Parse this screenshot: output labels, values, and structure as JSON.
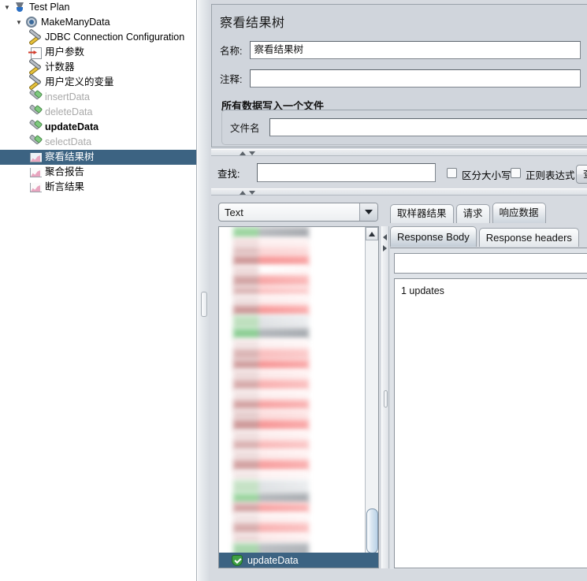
{
  "tree": {
    "items": [
      {
        "label": "Test Plan",
        "icon": "test-plan-icon",
        "indent": 1,
        "twisty": "▼",
        "state": "normal"
      },
      {
        "label": "MakeManyData",
        "icon": "thread-group-icon",
        "indent": 2,
        "twisty": "▼",
        "state": "normal"
      },
      {
        "label": "JDBC Connection Configuration",
        "icon": "config-element-icon",
        "indent": 3,
        "twisty": "",
        "state": "normal"
      },
      {
        "label": "用户参数",
        "icon": "user-parameters-icon",
        "indent": 3,
        "twisty": "",
        "state": "normal"
      },
      {
        "label": "计数器",
        "icon": "counter-icon",
        "indent": 3,
        "twisty": "",
        "state": "normal"
      },
      {
        "label": "用户定义的变量",
        "icon": "user-defined-variables-icon",
        "indent": 3,
        "twisty": "",
        "state": "normal"
      },
      {
        "label": "insertData",
        "icon": "jdbc-request-icon",
        "indent": 3,
        "twisty": "",
        "state": "disabled"
      },
      {
        "label": "deleteData",
        "icon": "jdbc-request-icon",
        "indent": 3,
        "twisty": "",
        "state": "disabled"
      },
      {
        "label": "updateData",
        "icon": "jdbc-request-icon",
        "indent": 3,
        "twisty": "",
        "state": "normal"
      },
      {
        "label": "selectData",
        "icon": "jdbc-request-icon",
        "indent": 3,
        "twisty": "",
        "state": "disabled"
      },
      {
        "label": "察看结果树",
        "icon": "view-results-tree-icon",
        "indent": 3,
        "twisty": "",
        "state": "selected"
      },
      {
        "label": "聚合报告",
        "icon": "aggregate-report-icon",
        "indent": 3,
        "twisty": "",
        "state": "normal"
      },
      {
        "label": "断言结果",
        "icon": "assertion-results-icon",
        "indent": 3,
        "twisty": "",
        "state": "normal"
      }
    ]
  },
  "panel": {
    "title": "察看结果树",
    "name_label": "名称:",
    "name_value": "察看结果树",
    "comment_label": "注释:",
    "comment_value": "",
    "group_title": "所有数据写入一个文件",
    "filename_label": "文件名",
    "filename_value": ""
  },
  "search": {
    "label": "查找:",
    "value": "",
    "case_sensitive_label": "区分大小写",
    "case_sensitive_checked": false,
    "regex_label": "正则表达式",
    "regex_checked": false,
    "find_button_label": "查找"
  },
  "renderer": {
    "selected": "Text"
  },
  "results_tree": {
    "selected_item": "updateData",
    "selected_icon": "success-shield-icon"
  },
  "result_tabs": {
    "items": [
      {
        "label": "取样器结果",
        "active": false
      },
      {
        "label": "请求",
        "active": false
      },
      {
        "label": "响应数据",
        "active": true
      }
    ]
  },
  "response_tabs": {
    "items": [
      {
        "label": "Response Body",
        "active": true
      },
      {
        "label": "Response headers",
        "active": false
      }
    ]
  },
  "response": {
    "find_value": "",
    "body_text": "1 updates"
  },
  "colors": {
    "selection_blue": "#3c6382",
    "panel_bg": "#d6dae0",
    "settings_bg": "#d0d5dc",
    "tree_bg": "#ffffff",
    "disabled_text": "#a9a9a9"
  }
}
